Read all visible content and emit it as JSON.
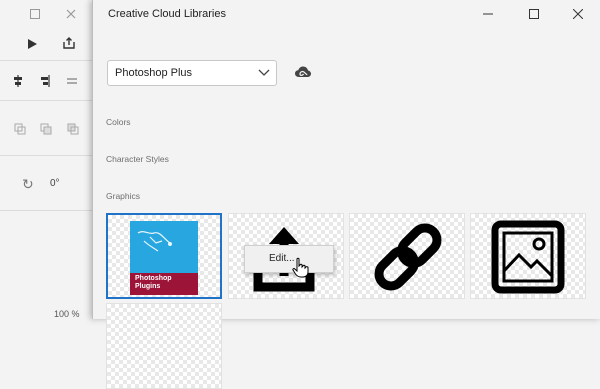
{
  "background_app": {
    "rotation_value": "0°",
    "zoom_value": "100 %",
    "icons": [
      "minimize-icon",
      "close-icon",
      "play-icon",
      "share-icon",
      "align-center-icon",
      "align-right-icon",
      "align-justify-icon",
      "copy-icon",
      "duplicate-icon",
      "arrange-icon",
      "rotate-icon"
    ]
  },
  "window": {
    "title": "Creative Cloud Libraries",
    "controls": [
      "minimize-icon",
      "maximize-icon",
      "close-icon"
    ]
  },
  "library_select": {
    "value": "Photoshop Plus",
    "icon": "chevron-down-icon"
  },
  "sync_icon": "creative-cloud-icon",
  "sections": {
    "colors": "Colors",
    "character_styles": "Character Styles",
    "graphics": "Graphics"
  },
  "graphics": [
    {
      "name": "photoshop-plugins-graphic",
      "caption_line1": "Photoshop",
      "caption_line2": "Plugins",
      "selected": true
    },
    {
      "name": "share-export-graphic",
      "icon": "share-icon"
    },
    {
      "name": "link-graphic",
      "icon": "link-icon"
    },
    {
      "name": "image-graphic",
      "icon": "image-icon"
    }
  ],
  "context_menu": {
    "items": [
      "Edit..."
    ]
  },
  "colors": {
    "accent": "#1e73c8",
    "plugin_blue": "#27a6df",
    "plugin_red": "#9c1438"
  }
}
